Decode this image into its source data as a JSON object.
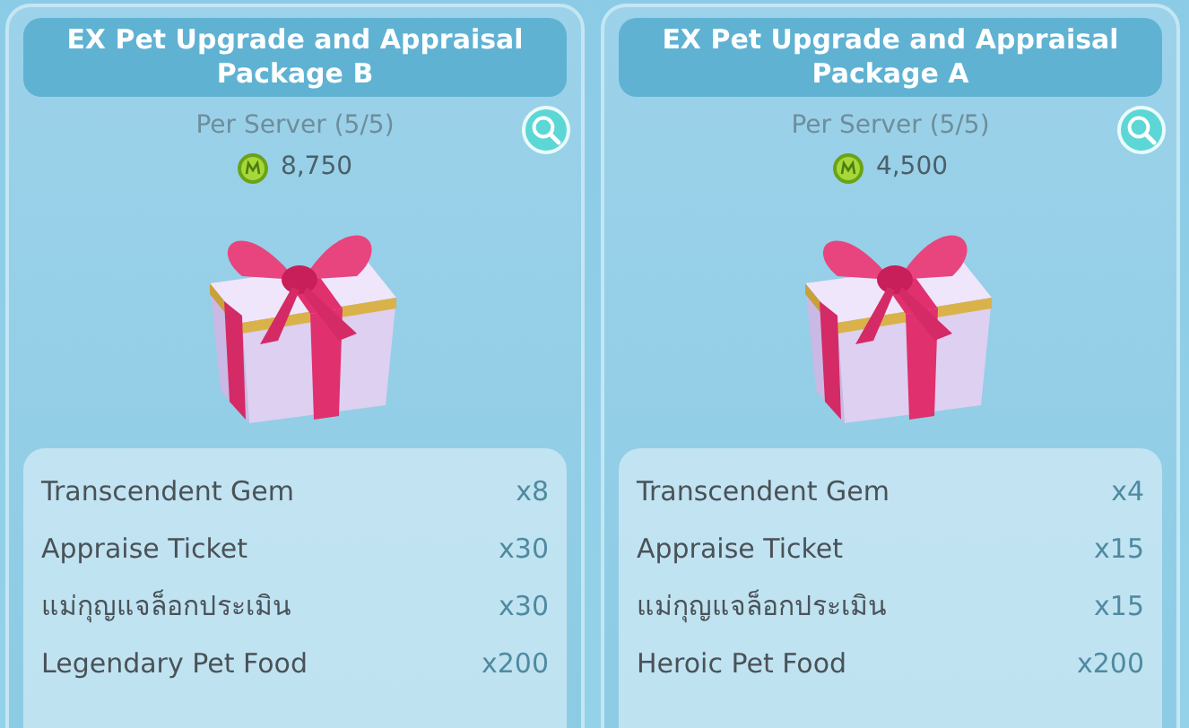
{
  "packages": [
    {
      "title": "EX Pet Upgrade and Appraisal Package B",
      "limit": "Per Server (5/5)",
      "price": "8,750",
      "items": [
        {
          "name": "Transcendent Gem",
          "qty": "x8"
        },
        {
          "name": "Appraise Ticket",
          "qty": "x30"
        },
        {
          "name": "แม่กุญแจล็อกประเมิน",
          "qty": "x30"
        },
        {
          "name": "Legendary Pet Food",
          "qty": "x200"
        }
      ]
    },
    {
      "title": "EX Pet Upgrade and Appraisal Package A",
      "limit": "Per Server (5/5)",
      "price": "4,500",
      "items": [
        {
          "name": "Transcendent Gem",
          "qty": "x4"
        },
        {
          "name": "Appraise Ticket",
          "qty": "x15"
        },
        {
          "name": "แม่กุญแจล็อกประเมิน",
          "qty": "x15"
        },
        {
          "name": "Heroic Pet Food",
          "qty": "x200"
        }
      ]
    }
  ]
}
